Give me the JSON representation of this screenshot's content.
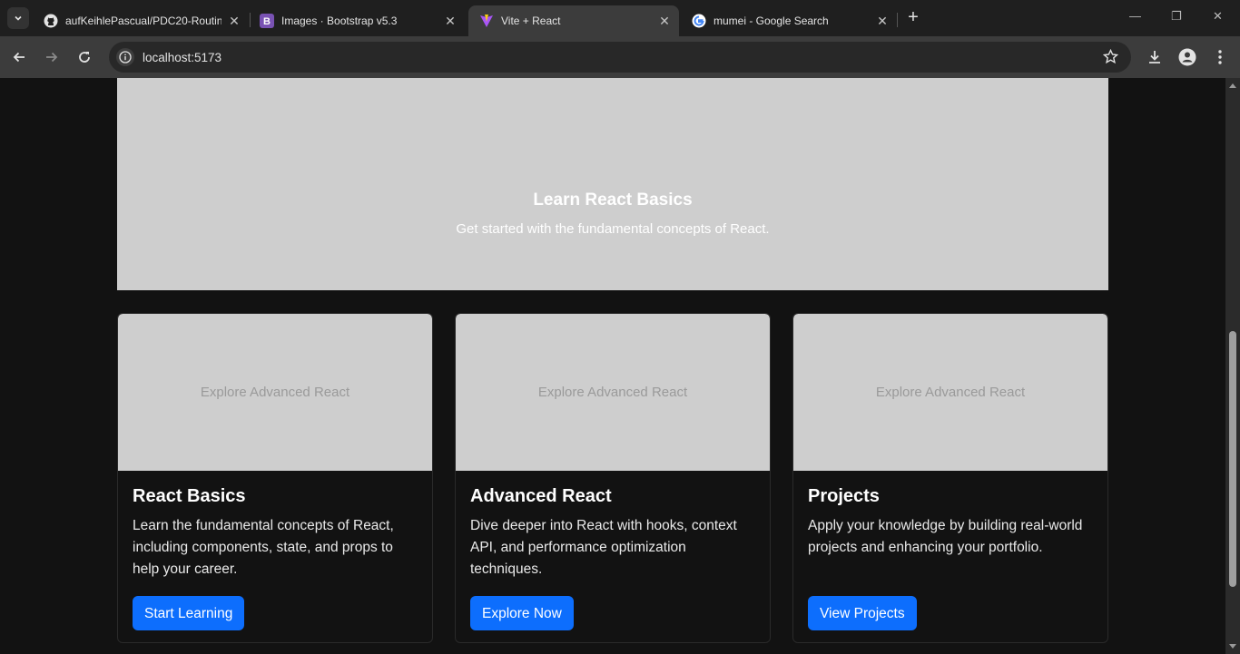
{
  "browser": {
    "tabs": [
      {
        "title": "aufKeihlePascual/PDC20-Routin",
        "favicon": "github-icon"
      },
      {
        "title": "Images · Bootstrap v5.3",
        "favicon": "bootstrap-icon"
      },
      {
        "title": "Vite + React",
        "favicon": "vite-icon",
        "active": true
      },
      {
        "title": "mumei - Google Search",
        "favicon": "google-icon"
      }
    ],
    "url": "localhost:5173"
  },
  "hero": {
    "title": "Learn React Basics",
    "subtitle": "Get started with the fundamental concepts of React."
  },
  "cards": [
    {
      "image_alt": "Explore Advanced React",
      "title": "React Basics",
      "text": "Learn the fundamental concepts of React, including components, state, and props to help your career.",
      "button": "Start Learning"
    },
    {
      "image_alt": "Explore Advanced React",
      "title": "Advanced React",
      "text": "Dive deeper into React with hooks, context API, and performance optimization techniques.",
      "button": "Explore Now"
    },
    {
      "image_alt": "Explore Advanced React",
      "title": "Projects",
      "text": "Apply your knowledge by building real-world projects and enhancing your portfolio.",
      "button": "View Projects"
    }
  ],
  "colors": {
    "primary_button": "#0d6efd",
    "placeholder": "#cecece",
    "page_background": "#121212"
  }
}
